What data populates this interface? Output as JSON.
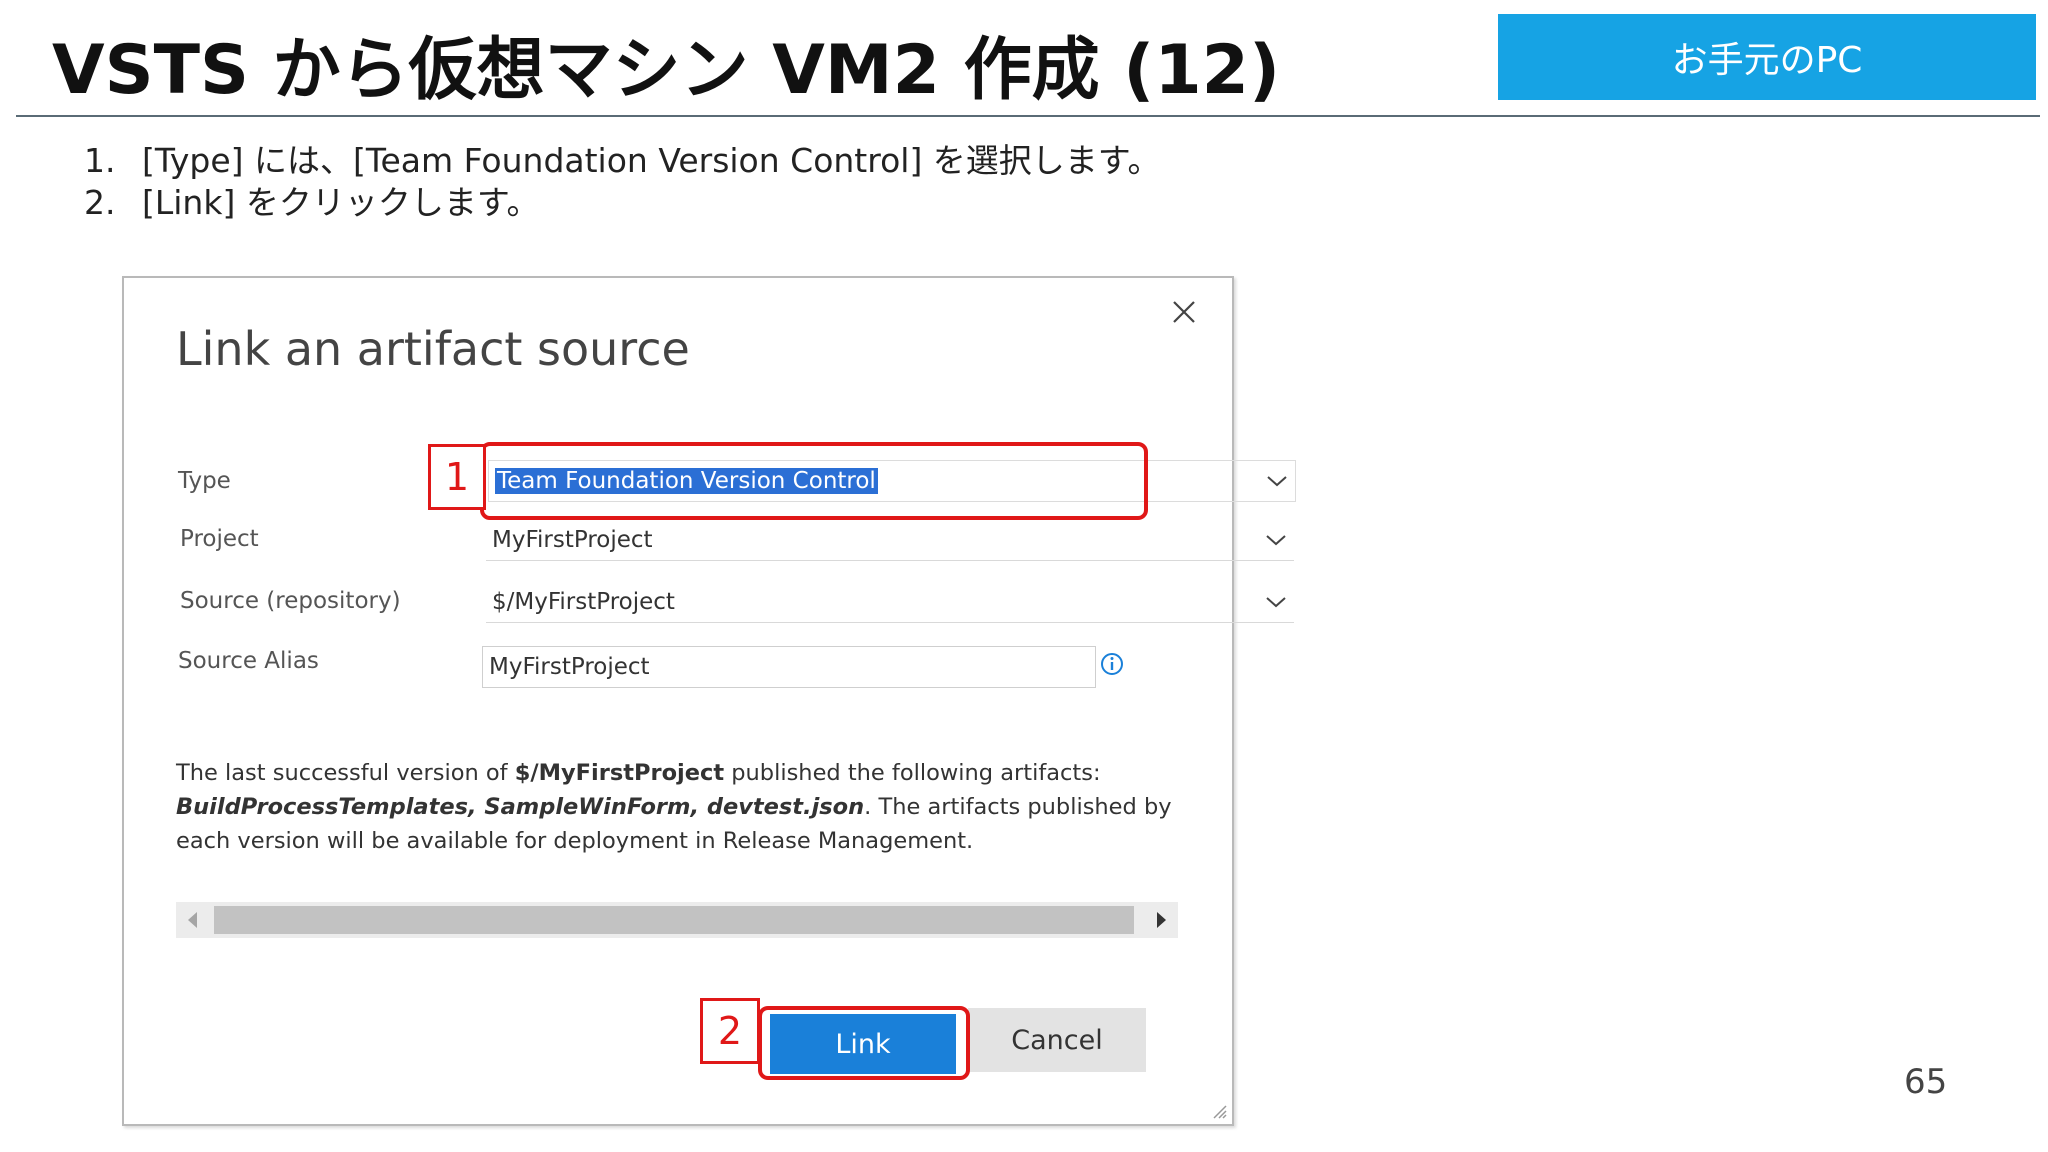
{
  "slide": {
    "title": "VSTS から仮想マシン VM2 作成 (12)",
    "badge": "お手元のPC",
    "steps": [
      {
        "num": "1.",
        "text": "[Type] には、[Team Foundation Version Control] を選択します。"
      },
      {
        "num": "2.",
        "text": "[Link] をクリックします。"
      }
    ],
    "page_number": "65"
  },
  "dialog": {
    "title": "Link an artifact source",
    "fields": {
      "type": {
        "label": "Type",
        "value": "Team Foundation Version Control"
      },
      "project": {
        "label": "Project",
        "value": "MyFirstProject"
      },
      "source": {
        "label": "Source (repository)",
        "value": "$/MyFirstProject"
      },
      "alias": {
        "label": "Source Alias",
        "value": "MyFirstProject"
      }
    },
    "description": {
      "p1": "The last successful version of ",
      "repo": "$/MyFirstProject",
      "p2": " published the following artifacts: ",
      "artifacts": "BuildProcessTemplates, SampleWinForm, devtest.json",
      "p3": ". The artifacts published by each version will be available for deployment in Release Management."
    },
    "buttons": {
      "link": "Link",
      "cancel": "Cancel"
    }
  },
  "callouts": {
    "one": "1",
    "two": "2"
  },
  "colors": {
    "accent": "#16a3e4",
    "callout": "#e01818",
    "primary_button": "#1a80d9",
    "selection": "#2b6fd5"
  }
}
